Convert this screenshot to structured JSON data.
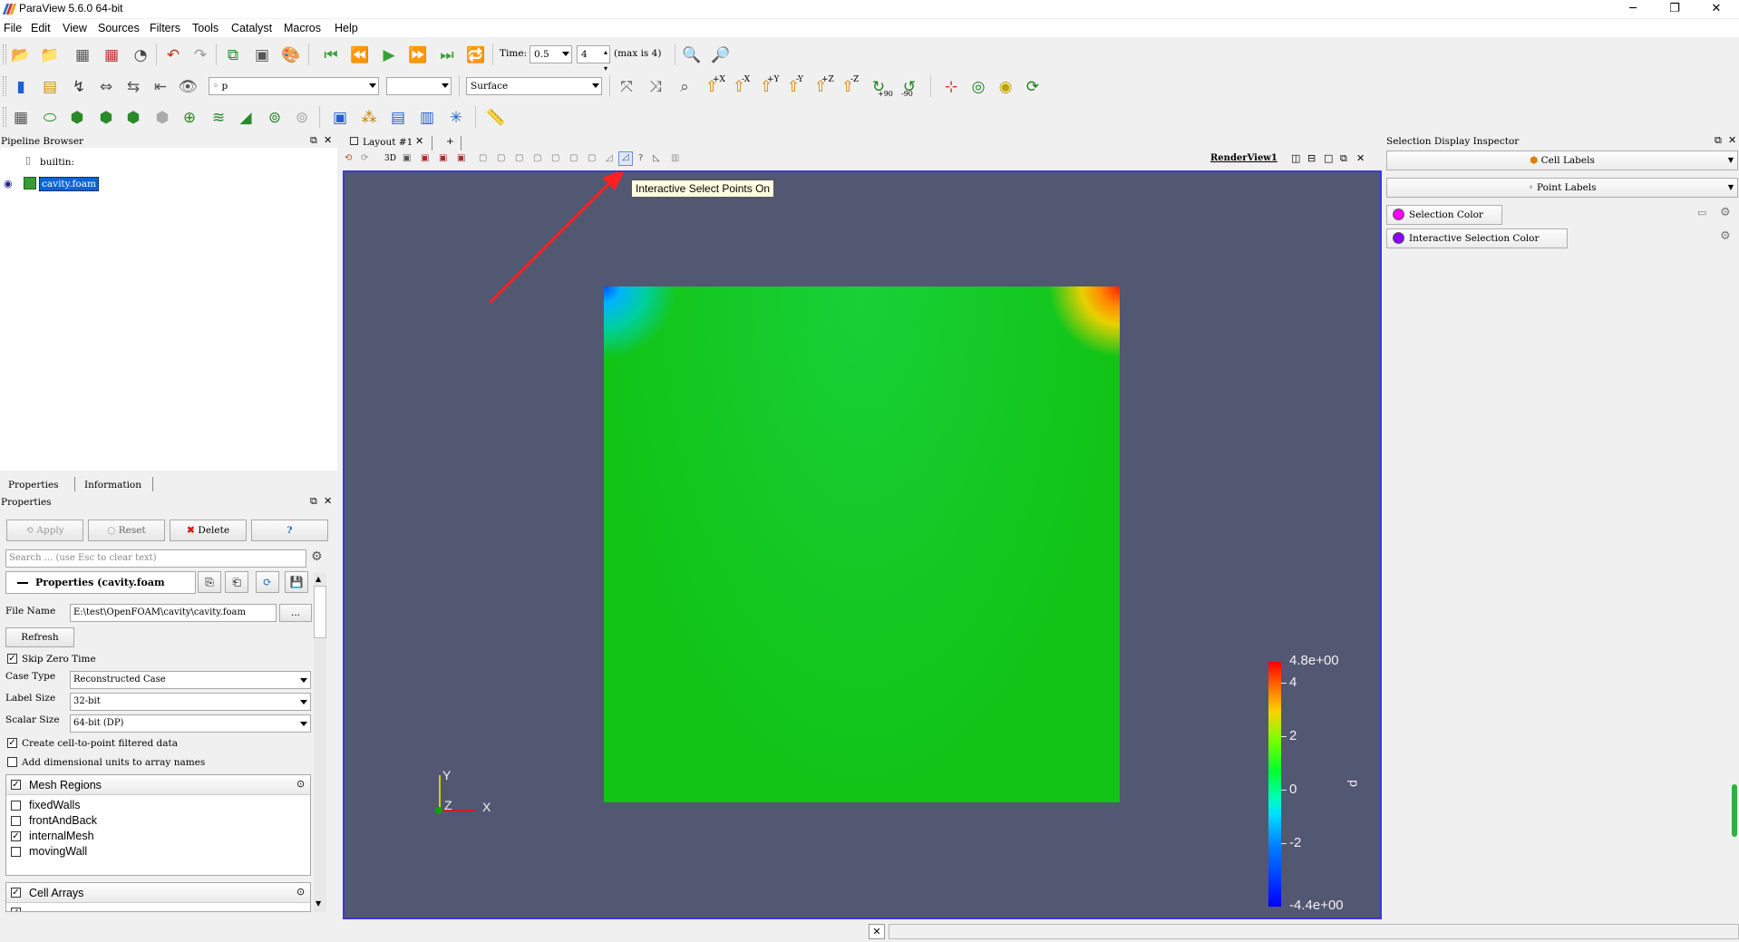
{
  "window": {
    "title": "ParaView 5.6.0 64-bit"
  },
  "menu": [
    "File",
    "Edit",
    "View",
    "Sources",
    "Filters",
    "Tools",
    "Catalyst",
    "Macros",
    "Help"
  ],
  "toolbar": {
    "time_label": "Time:",
    "time_value": "0.5",
    "timestep_value": "4",
    "max_label": "(max is 4)",
    "color_array": "p",
    "representation": "Surface",
    "camera_labels": {
      "pos_x": "+X",
      "neg_x": "-X",
      "pos_y": "+Y",
      "neg_y": "-Y",
      "pos_z": "+Z",
      "neg_z": "-Z",
      "rot_p90": "+90",
      "rot_n90": "-90"
    }
  },
  "pipeline": {
    "title": "Pipeline Browser",
    "items": [
      {
        "label": "builtin:"
      },
      {
        "label": "cavity.foam"
      }
    ]
  },
  "tabs": {
    "properties": "Properties",
    "information": "Information"
  },
  "properties": {
    "title": "Properties",
    "apply": "Apply",
    "reset": "Reset",
    "delete": "Delete",
    "help": "?",
    "search_placeholder": "Search ... (use Esc to clear text)",
    "section_title": "Properties (cavity.foam",
    "file_name_label": "File Name",
    "file_name_value": "E:\\test\\OpenFOAM\\cavity\\cavity.foam",
    "browse": "...",
    "refresh": "Refresh",
    "skip_zero_time": "Skip Zero Time",
    "case_type_label": "Case Type",
    "case_type_value": "Reconstructed Case",
    "label_size_label": "Label Size",
    "label_size_value": "32-bit",
    "scalar_size_label": "Scalar Size",
    "scalar_size_value": "64-bit (DP)",
    "create_cell_to_point": "Create cell-to-point filtered data",
    "add_dimensional_units": "Add dimensional units to array names",
    "mesh_regions_title": "Mesh Regions",
    "mesh_regions": [
      {
        "label": "fixedWalls",
        "checked": false
      },
      {
        "label": "frontAndBack",
        "checked": false
      },
      {
        "label": "internalMesh",
        "checked": true
      },
      {
        "label": "movingWall",
        "checked": false
      }
    ],
    "cell_arrays_title": "Cell Arrays"
  },
  "layout": {
    "tab_label": "Layout #1",
    "add_tab": "+",
    "mode_3d": "3D",
    "render_view_label": "RenderView1"
  },
  "tooltip": "Interactive Select Points On",
  "render": {
    "colorbar": {
      "title": "p",
      "max_label": "4.8e+00",
      "min_label": "-4.4e+00",
      "ticks": [
        "4",
        "2",
        "0",
        "-2"
      ],
      "range": [
        -4.4,
        4.8
      ]
    },
    "axes": {
      "x": "X",
      "y": "Y",
      "z": "Z"
    },
    "background_color": "#525772"
  },
  "inspector": {
    "title": "Selection Display Inspector",
    "cell_labels": "Cell Labels",
    "point_labels": "Point Labels",
    "selection_color": "Selection Color",
    "interactive_selection_color": "Interactive Selection Color",
    "selection_color_value": "#ff00ff",
    "interactive_selection_color_value": "#8a00ff"
  }
}
